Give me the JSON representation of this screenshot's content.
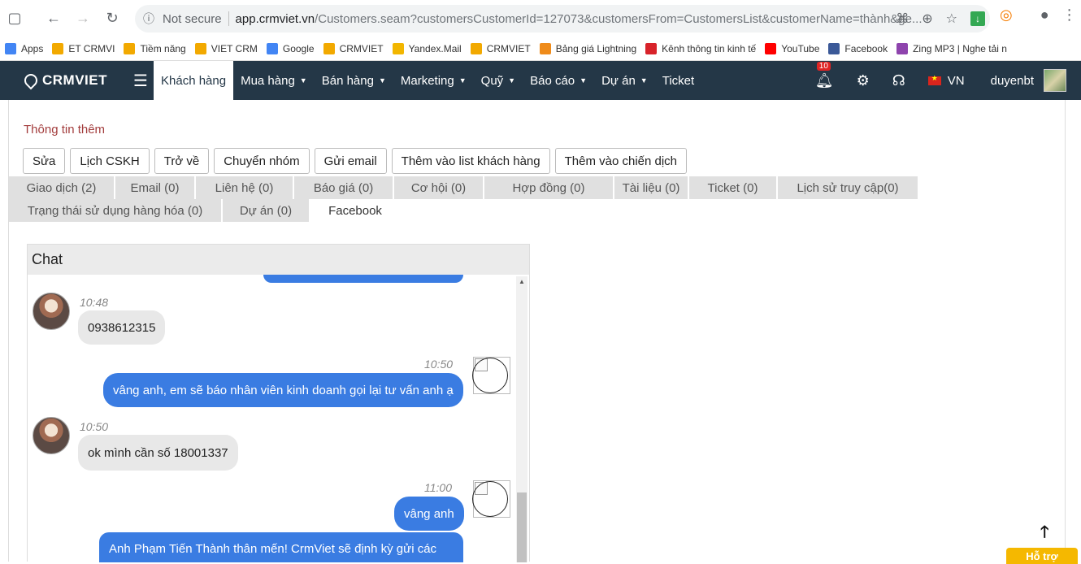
{
  "browser": {
    "not_secure": "Not secure",
    "url_host": "app.crmviet.vn",
    "url_path": "/Customers.seam?customersCustomerId=127073&customersFrom=CustomersList&customerName=thành&ge..."
  },
  "bookmarks": [
    {
      "label": "Apps",
      "icon": "apps-grid-icon",
      "color": "#4285f4"
    },
    {
      "label": "ET CRMVI",
      "icon": "crmviet-icon",
      "color": "#f2a900"
    },
    {
      "label": "Tiềm năng",
      "icon": "crmviet-icon",
      "color": "#f2a900"
    },
    {
      "label": "VIET CRM",
      "icon": "crmviet-icon",
      "color": "#f2a900"
    },
    {
      "label": "Google",
      "icon": "google-icon",
      "color": "#4285f4"
    },
    {
      "label": "CRMVIET",
      "icon": "crmviet-icon",
      "color": "#f2a900"
    },
    {
      "label": "Yandex.Mail",
      "icon": "mail-icon",
      "color": "#f2b600"
    },
    {
      "label": "CRMVIET",
      "icon": "crmviet-icon",
      "color": "#f2a900"
    },
    {
      "label": "Bảng giá Lightning",
      "icon": "d-icon",
      "color": "#ef8b1a"
    },
    {
      "label": "Kênh thông tin kinh tế",
      "icon": "f-icon",
      "color": "#d8232a"
    },
    {
      "label": "YouTube",
      "icon": "youtube-icon",
      "color": "#ff0000"
    },
    {
      "label": "Facebook",
      "icon": "facebook-icon",
      "color": "#3b5998"
    },
    {
      "label": "Zing MP3 | Nghe tải n",
      "icon": "zing-icon",
      "color": "#8e44ad"
    }
  ],
  "nav": {
    "brand": "CRMVIET",
    "items": [
      {
        "label": "Khách hàng",
        "active": true,
        "caret": false
      },
      {
        "label": "Mua hàng",
        "active": false,
        "caret": true
      },
      {
        "label": "Bán hàng",
        "active": false,
        "caret": true
      },
      {
        "label": "Marketing",
        "active": false,
        "caret": true
      },
      {
        "label": "Quỹ",
        "active": false,
        "caret": true
      },
      {
        "label": "Báo cáo",
        "active": false,
        "caret": true
      },
      {
        "label": "Dự án",
        "active": false,
        "caret": true
      },
      {
        "label": "Ticket",
        "active": false,
        "caret": false
      }
    ],
    "notification_count": "10",
    "language": "VN",
    "username": "duyenbt"
  },
  "section_title": "Thông tin thêm",
  "toolbar": [
    "Sửa",
    "Lịch CSKH",
    "Trở về",
    "Chuyển nhóm",
    "Gửi email",
    "Thêm vào list khách hàng",
    "Thêm vào chiến dịch"
  ],
  "tabs_row1": [
    "Giao dịch (2)",
    "Email (0)",
    "Liên hệ (0)",
    "Báo giá (0)",
    "Cơ hội (0)",
    "Hợp đồng (0)",
    "Tài liệu (0)",
    "Ticket (0)",
    "Lịch sử truy cập(0)"
  ],
  "tabs_row2": [
    "Trạng thái sử dụng hàng hóa (0)",
    "Dự án (0)",
    "Facebook"
  ],
  "active_tab": "Facebook",
  "chat": {
    "title": "Chat",
    "messages": [
      {
        "dir": "in",
        "time": "10:48",
        "text": "0938612315"
      },
      {
        "dir": "out",
        "time": "10:50",
        "text": "vâng anh, em sẽ báo nhân viên kinh doanh gọi lại tư vấn anh ạ"
      },
      {
        "dir": "in",
        "time": "10:50",
        "text": "ok mình cần số 18001337"
      },
      {
        "dir": "out",
        "time": "11:00",
        "text": "vâng anh"
      },
      {
        "dir": "out",
        "time": "",
        "text": "Anh Phạm Tiến Thành thân mến! CrmViet sẽ định kỳ gửi các"
      }
    ]
  },
  "help_label": "Hỗ trợ"
}
